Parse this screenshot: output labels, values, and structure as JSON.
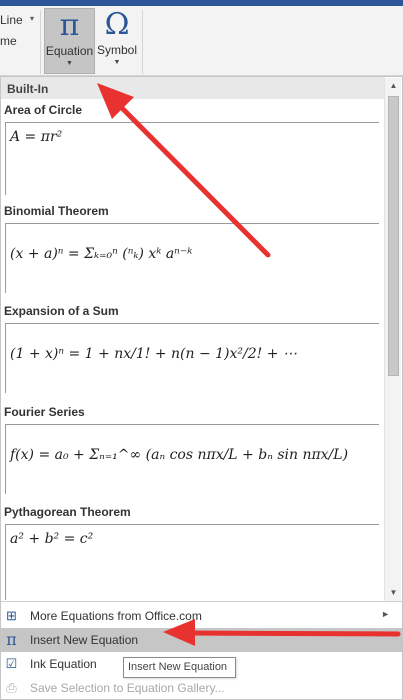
{
  "ribbon": {
    "left_labels": [
      "Line",
      "me"
    ],
    "equation": {
      "glyph": "π",
      "label": "Equation"
    },
    "symbol": {
      "glyph": "Ω",
      "label": "Symbol"
    }
  },
  "gallery": {
    "section": "Built-In",
    "equations": [
      {
        "title": "Area of Circle",
        "formula": "A = πr²"
      },
      {
        "title": "Binomial Theorem",
        "formula": "(x + a)ⁿ = Σₖ₌₀ⁿ (ⁿₖ) xᵏ aⁿ⁻ᵏ"
      },
      {
        "title": "Expansion of a Sum",
        "formula": "(1 + x)ⁿ = 1 + nx/1! + n(n − 1)x²/2! + ⋯"
      },
      {
        "title": "Fourier Series",
        "formula": "f(x) = a₀ + Σₙ₌₁^∞ (aₙ cos nπx/L + bₙ sin nπx/L)"
      },
      {
        "title": "Pythagorean Theorem",
        "formula": "a² + b² = c²"
      }
    ]
  },
  "menu": {
    "more": "More Equations from Office.com",
    "insert_new": "Insert New Equation",
    "ink": "Ink Equation",
    "save_selection": "Save Selection to Equation Gallery..."
  },
  "tooltip": "Insert New Equation",
  "colors": {
    "accent": "#2b5797",
    "arrow": "#e8322f",
    "highlight": "#c6c6c6"
  }
}
